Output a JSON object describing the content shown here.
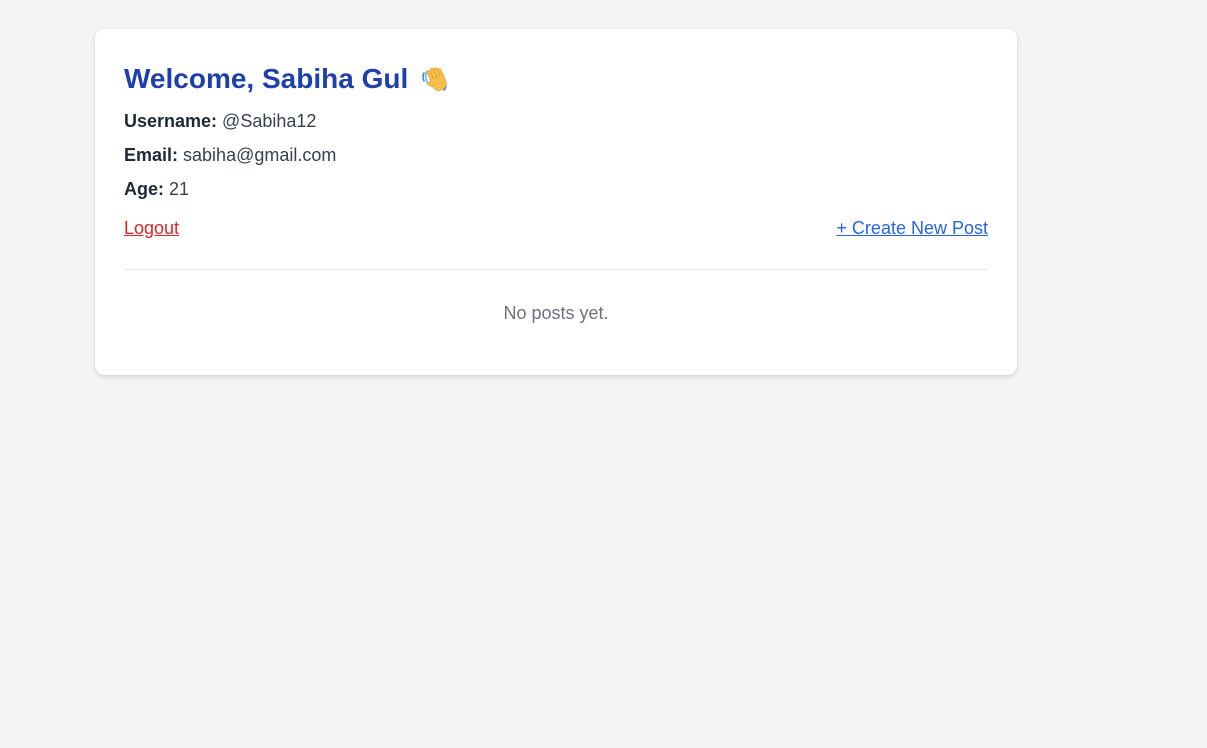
{
  "profile": {
    "welcome_text": "Welcome, Sabiha Gul",
    "wave_icon": "waving-hand-icon",
    "username_label": "Username:",
    "username_value": "@Sabiha12",
    "email_label": "Email:",
    "email_value": "sabiha@gmail.com",
    "age_label": "Age:",
    "age_value": "21"
  },
  "actions": {
    "logout_label": "Logout",
    "create_post_label": "+ Create New Post"
  },
  "posts": {
    "empty_message": "No posts yet."
  },
  "colors": {
    "background": "#f3f4f6",
    "heading": "#1e40af",
    "logout": "#dc2626",
    "link": "#2563eb",
    "muted": "#6b7280"
  }
}
